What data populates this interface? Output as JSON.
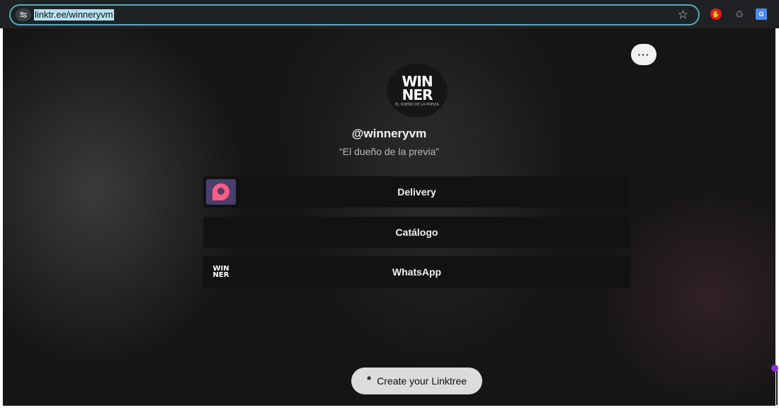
{
  "browser": {
    "url": "linktr.ee/winneryvm",
    "site_info_icon": "tune-icon",
    "bookmark_icon": "star-icon",
    "extensions": [
      {
        "name": "adblock-extension-icon",
        "glyph": "✋"
      },
      {
        "name": "recycle-extension-icon",
        "glyph": "♻"
      },
      {
        "name": "translate-extension-icon",
        "glyph": "G"
      }
    ]
  },
  "profile": {
    "more_label": "···",
    "avatar_logo": {
      "line1": "WIN",
      "line2": "NER",
      "sub": "EL DUEÑO DE LA PREVIA"
    },
    "handle": "@winneryvm",
    "bio": "“El dueño de la previa”"
  },
  "links": [
    {
      "label": "Delivery",
      "thumb": "pedidosya-icon"
    },
    {
      "label": "Catálogo",
      "thumb": ""
    },
    {
      "label": "WhatsApp",
      "thumb": "winnery-logo-icon"
    }
  ],
  "footer": {
    "create_label": "Create your Linktree",
    "create_icon": "*"
  },
  "colors": {
    "accent_url_bar": "#5aa9b7",
    "page_bg": "#151515",
    "link_bg": "#121212",
    "create_btn_bg": "#dcdcdc"
  }
}
